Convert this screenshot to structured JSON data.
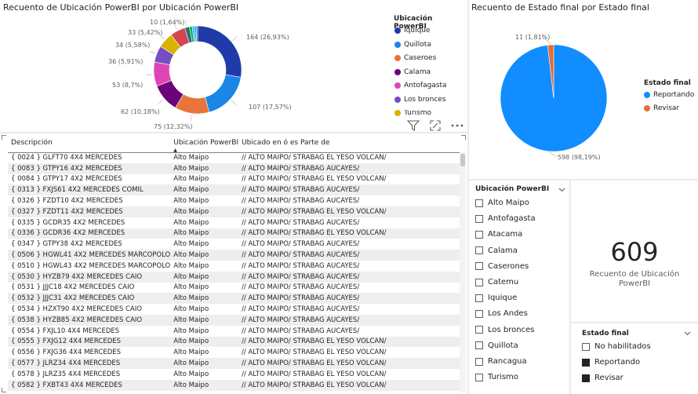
{
  "donut": {
    "title": "Recuento de Ubicación PowerBI por Ubicación PowerBI",
    "legend_title": "Ubicación PowerBI",
    "legend": [
      {
        "label": "Iquique",
        "color": "#1f3ba8"
      },
      {
        "label": "Quillota",
        "color": "#1a86e8"
      },
      {
        "label": "Caseroes",
        "color": "#e8743b"
      },
      {
        "label": "Calama",
        "color": "#6b047a"
      },
      {
        "label": "Antofagasta",
        "color": "#e045b8"
      },
      {
        "label": "Los bronces",
        "color": "#744ec2"
      },
      {
        "label": "Turismo",
        "color": "#d9b300"
      }
    ],
    "slices": [
      {
        "value": 164,
        "label": "164 (26,93%)",
        "color": "#1f3ba8"
      },
      {
        "value": 107,
        "label": "107 (17,57%)",
        "color": "#1a86e8"
      },
      {
        "value": 75,
        "label": "75 (12,32%)",
        "color": "#e8743b"
      },
      {
        "value": 62,
        "label": "62 (10,18%)",
        "color": "#6b047a"
      },
      {
        "value": 53,
        "label": "53 (8,7%)",
        "color": "#e045b8"
      },
      {
        "value": 36,
        "label": "36 (5,91%)",
        "color": "#744ec2"
      },
      {
        "value": 34,
        "label": "34 (5,58%)",
        "color": "#d9b300"
      },
      {
        "value": 33,
        "label": "33 (5,42%)",
        "color": "#d64550"
      },
      {
        "value": 10,
        "label": "10 (1,64%)",
        "color": "#197278"
      },
      {
        "value": 6,
        "label": "",
        "color": "#1aab40"
      },
      {
        "value": 5,
        "label": "",
        "color": "#15c6f4"
      },
      {
        "value": 4,
        "label": "",
        "color": "#4092ff"
      },
      {
        "value": 3,
        "label": "",
        "color": "#2e5e9a"
      }
    ]
  },
  "pie": {
    "title": "Recuento de Estado final por Estado final",
    "legend_title": "Estado final",
    "legend": [
      {
        "label": "Reportando",
        "color": "#118dff"
      },
      {
        "label": "Revisar",
        "color": "#e66c37"
      }
    ],
    "slices": [
      {
        "value": 598,
        "label": "598 (98,19%)",
        "color": "#118dff"
      },
      {
        "value": 11,
        "label": "11 (1,81%)",
        "color": "#e66c37"
      }
    ]
  },
  "table": {
    "columns": [
      "Descripción",
      "Ubicación PowerBI",
      "Ubicado en ó es Parte de"
    ],
    "rows": [
      [
        "{ 0024 } GLFT70 4X4 MERCEDES",
        "Alto Maipo",
        "// ALTO MAIPO/ STRABAG EL YESO VOLCAN/"
      ],
      [
        "{ 0083 } GTPY16 4X2 MERCEDES",
        "Alto Maipo",
        "// ALTO MAIPO/ STRABAG AUCAYES/"
      ],
      [
        "{ 0084 } GTPY17 4X2 MERCEDES",
        "Alto Maipo",
        "// ALTO MAIPO/ STRABAG EL YESO VOLCAN/"
      ],
      [
        "{ 0313 } FXJS61 4X2 MERCEDES COMIL",
        "Alto Maipo",
        "// ALTO MAIPO/ STRABAG AUCAYES/"
      ],
      [
        "{ 0326 } FZDT10 4X2 MERCEDES",
        "Alto Maipo",
        "// ALTO MAIPO/ STRABAG AUCAYES/"
      ],
      [
        "{ 0327 } FZDT11 4X2 MERCEDES",
        "Alto Maipo",
        "// ALTO MAIPO/ STRABAG EL YESO VOLCAN/"
      ],
      [
        "{ 0335 } GCDR35 4X2 MERCEDES",
        "Alto Maipo",
        "// ALTO MAIPO/ STRABAG AUCAYES/"
      ],
      [
        "{ 0336 } GCDR36 4X2 MERCEDES",
        "Alto Maipo",
        "// ALTO MAIPO/ STRABAG EL YESO VOLCAN/"
      ],
      [
        "{ 0347 } GTPY38 4X2 MERCEDES",
        "Alto Maipo",
        "// ALTO MAIPO/ STRABAG AUCAYES/"
      ],
      [
        "{ 0506 } HGWL41 4X2 MERCEDES MARCOPOLO",
        "Alto Maipo",
        "// ALTO MAIPO/ STRABAG AUCAYES/"
      ],
      [
        "{ 0510 } HGWL43 4X2 MERCEDES MARCOPOLO",
        "Alto Maipo",
        "// ALTO MAIPO/ STRABAG AUCAYES/"
      ],
      [
        "{ 0530 } HYZB79 4X2 MERCEDES CAIO",
        "Alto Maipo",
        "// ALTO MAIPO/ STRABAG AUCAYES/"
      ],
      [
        "{ 0531 } JJJC18 4X2 MERCEDES CAIO",
        "Alto Maipo",
        "// ALTO MAIPO/ STRABAG AUCAYES/"
      ],
      [
        "{ 0532 } JJJC31 4X2 MERCEDES CAIO",
        "Alto Maipo",
        "// ALTO MAIPO/ STRABAG AUCAYES/"
      ],
      [
        "{ 0534 } HZXT90 4X2 MERCEDES CAIO",
        "Alto Maipo",
        "// ALTO MAIPO/ STRABAG AUCAYES/"
      ],
      [
        "{ 0538 } HYZB85 4X2 MERCEDES CAIO",
        "Alto Maipo",
        "// ALTO MAIPO/ STRABAG AUCAYES/"
      ],
      [
        "{ 0554 } FXJL10 4X4 MERCEDES",
        "Alto Maipo",
        "// ALTO MAIPO/ STRABAG AUCAYES/"
      ],
      [
        "{ 0555 } FXJG12 4X4 MERCEDES",
        "Alto Maipo",
        "// ALTO MAIPO/ STRABAG EL YESO VOLCAN/"
      ],
      [
        "{ 0556 } FXJG36 4X4 MERCEDES",
        "Alto Maipo",
        "// ALTO MAIPO/ STRABAG EL YESO VOLCAN/"
      ],
      [
        "{ 0577 } JLRZ34 4X4 MERCEDES",
        "Alto Maipo",
        "// ALTO MAIPO/ STRABAG EL YESO VOLCAN/"
      ],
      [
        "{ 0578 } JLRZ35 4X4 MERCEDES",
        "Alto Maipo",
        "// ALTO MAIPO/ STRABAG EL YESO VOLCAN/"
      ],
      [
        "{ 0582 } FXBT43 4X4 MERCEDES",
        "Alto Maipo",
        "// ALTO MAIPO/ STRABAG EL YESO VOLCAN/"
      ]
    ]
  },
  "slicer_ubicacion": {
    "title": "Ubicación PowerBI",
    "items": [
      "Alto Maipo",
      "Antofagasta",
      "Atacama",
      "Calama",
      "Caserones",
      "Catemu",
      "Iquique",
      "Los Andes",
      "Los bronces",
      "Quillota",
      "Rancagua",
      "Turismo"
    ]
  },
  "card": {
    "value": "609",
    "label": "Recuento de Ubicación PowerBI"
  },
  "slicer_estado": {
    "title": "Estado final",
    "items": [
      {
        "label": "No habilitados",
        "checked": false
      },
      {
        "label": "Reportando",
        "checked": true
      },
      {
        "label": "Revisar",
        "checked": true
      }
    ]
  }
}
